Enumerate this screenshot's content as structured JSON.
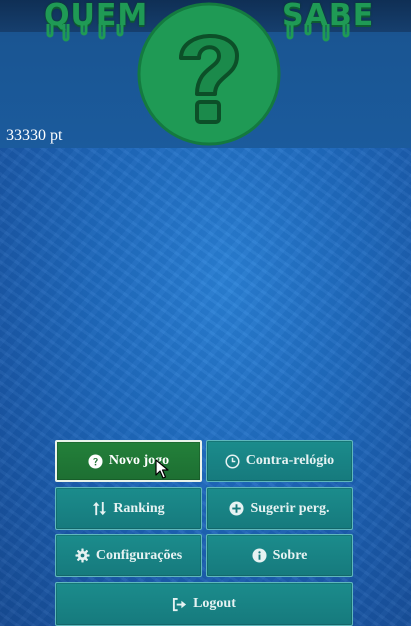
{
  "brand": {
    "left_word": "QUEM",
    "right_word": "SABE",
    "logo_icon": "question-mark-circle-icon",
    "accent": "#1f9a55"
  },
  "status": {
    "points": "33330 pt"
  },
  "menu": {
    "new_game": "Novo jogo",
    "time_trial": "Contra-relógio",
    "ranking": "Ranking",
    "suggest": "Sugerir perg.",
    "settings": "Configurações",
    "about": "Sobre",
    "logout": "Logout"
  },
  "colors": {
    "primary_button": "#23803a",
    "secondary_button": "#1b8c8c",
    "background": "#1f6bc0"
  }
}
